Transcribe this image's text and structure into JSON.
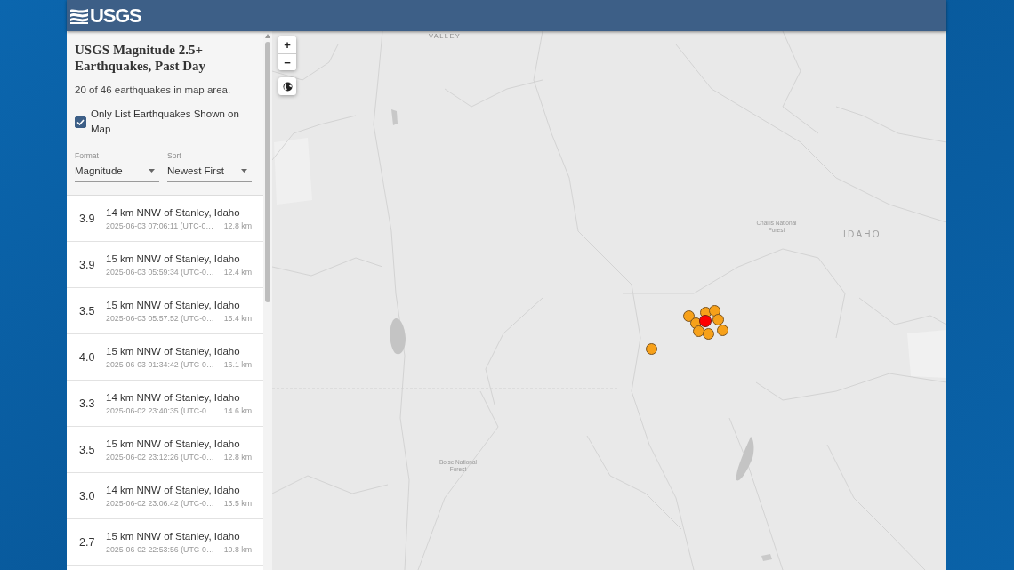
{
  "header": {
    "logo": "USGS"
  },
  "sidebar": {
    "title": "USGS Magnitude 2.5+ Earthquakes, Past Day",
    "summary": "20 of 46 earthquakes in map area.",
    "filter_checkbox": {
      "label": "Only List Earthquakes Shown on Map",
      "checked": true
    },
    "format": {
      "label": "Format",
      "value": "Magnitude"
    },
    "sort": {
      "label": "Sort",
      "value": "Newest First"
    },
    "earthquakes": [
      {
        "magnitude": "3.9",
        "place": "14 km NNW of Stanley, Idaho",
        "time": "2025-06-03 07:06:11 (UTC-0…",
        "depth": "12.8 km"
      },
      {
        "magnitude": "3.9",
        "place": "15 km NNW of Stanley, Idaho",
        "time": "2025-06-03 05:59:34 (UTC-0…",
        "depth": "12.4 km"
      },
      {
        "magnitude": "3.5",
        "place": "15 km NNW of Stanley, Idaho",
        "time": "2025-06-03 05:57:52 (UTC-0…",
        "depth": "15.4 km"
      },
      {
        "magnitude": "4.0",
        "place": "15 km NNW of Stanley, Idaho",
        "time": "2025-06-03 01:34:42 (UTC-0…",
        "depth": "16.1 km"
      },
      {
        "magnitude": "3.3",
        "place": "14 km NNW of Stanley, Idaho",
        "time": "2025-06-02 23:40:35 (UTC-0…",
        "depth": "14.6 km"
      },
      {
        "magnitude": "3.5",
        "place": "15 km NNW of Stanley, Idaho",
        "time": "2025-06-02 23:12:26 (UTC-0…",
        "depth": "12.8 km"
      },
      {
        "magnitude": "3.0",
        "place": "14 km NNW of Stanley, Idaho",
        "time": "2025-06-02 23:06:42 (UTC-0…",
        "depth": "13.5 km"
      },
      {
        "magnitude": "2.7",
        "place": "15 km NNW of Stanley, Idaho",
        "time": "2025-06-02 22:53:56 (UTC-0…",
        "depth": "10.8 km"
      }
    ]
  },
  "map": {
    "zoom_controls": [
      {
        "label": "+"
      },
      {
        "label": "−"
      }
    ],
    "labels": [
      {
        "kind": "region",
        "text": "VALLEY"
      },
      {
        "kind": "forest",
        "text": "Challis National Forest"
      },
      {
        "kind": "state",
        "text": "IDAHO"
      },
      {
        "kind": "forest",
        "text": "Boise National Forest"
      }
    ],
    "markers": [
      {
        "color": "#f7a11a"
      },
      {
        "color": "#f7a11a"
      },
      {
        "color": "#f7a11a"
      },
      {
        "color": "#f7a11a"
      },
      {
        "color": "#f7a11a"
      },
      {
        "color": "#f7a11a"
      },
      {
        "color": "#f7a11a"
      },
      {
        "color": "#f7a11a"
      },
      {
        "color": "#f7a11a"
      },
      {
        "color": "#ff0000"
      }
    ]
  }
}
